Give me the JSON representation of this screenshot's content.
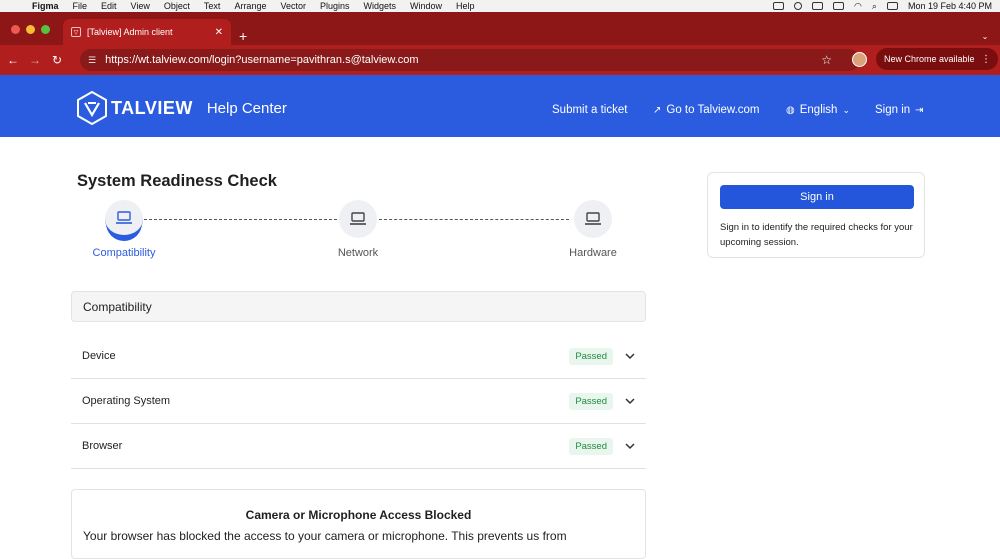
{
  "menubar": {
    "app": "Figma",
    "items": [
      "File",
      "Edit",
      "View",
      "Object",
      "Text",
      "Arrange",
      "Vector",
      "Plugins",
      "Widgets",
      "Window",
      "Help"
    ],
    "datetime": "Mon 19 Feb  4:40 PM"
  },
  "browser": {
    "tab_title": "[Talview] Admin client",
    "url": "https://wt.talview.com/login?username=pavithran.s@talview.com",
    "update_label": "New Chrome available",
    "colors": {
      "tabstrip": "#8d1717",
      "toolbar": "#b01e1e"
    }
  },
  "header": {
    "brand": "TALVIEW",
    "section": "Help Center",
    "nav": {
      "submit": "Submit a ticket",
      "goto": "Go to Talview.com",
      "language": "English",
      "signin": "Sign in"
    },
    "color": "#2b5ce0"
  },
  "main": {
    "title": "System Readiness Check",
    "steps": [
      {
        "label": "Compatibility",
        "active": true
      },
      {
        "label": "Network",
        "active": false
      },
      {
        "label": "Hardware",
        "active": false
      }
    ],
    "section_title": "Compatibility",
    "checks": [
      {
        "name": "Device",
        "status": "Passed"
      },
      {
        "name": "Operating System",
        "status": "Passed"
      },
      {
        "name": "Browser",
        "status": "Passed"
      }
    ],
    "alert": {
      "title": "Camera or Microphone Access Blocked",
      "body": "Your browser has blocked the access to your camera or microphone. This prevents us from"
    }
  },
  "sidebar": {
    "signin_button": "Sign in",
    "message": "Sign in to identify the required checks for your upcoming session."
  }
}
